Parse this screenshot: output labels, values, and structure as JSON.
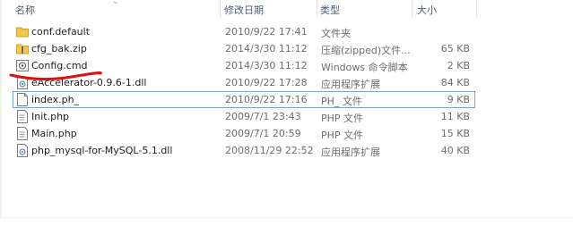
{
  "columns": {
    "name": "名称",
    "modified": "修改日期",
    "type": "类型",
    "size": "大小"
  },
  "files": [
    {
      "name": "conf.default",
      "modified": "2010/9/22 17:41",
      "type": "文件夹",
      "size": "",
      "icon": "folder-icon"
    },
    {
      "name": "cfg_bak.zip",
      "modified": "2014/3/30 11:12",
      "type": "压缩(zipped)文件...",
      "size": "65 KB",
      "icon": "zip-folder-icon"
    },
    {
      "name": "Config.cmd",
      "modified": "2014/3/30 11:12",
      "type": "Windows 命令脚本",
      "size": "2 KB",
      "icon": "cmd-script-icon"
    },
    {
      "name": "eAccelerator-0.9.6-1.dll",
      "modified": "2010/9/22 17:28",
      "type": "应用程序扩展",
      "size": "84 KB",
      "icon": "dll-icon"
    },
    {
      "name": "index.ph_",
      "modified": "2010/9/22 17:16",
      "type": "PH_ 文件",
      "size": "9 KB",
      "icon": "blank-file-icon"
    },
    {
      "name": "Init.php",
      "modified": "2009/7/1 23:43",
      "type": "PHP 文件",
      "size": "11 KB",
      "icon": "text-file-icon"
    },
    {
      "name": "Main.php",
      "modified": "2009/7/1 20:59",
      "type": "PHP 文件",
      "size": "15 KB",
      "icon": "text-file-icon"
    },
    {
      "name": "php_mysql-for-MySQL-5.1.dll",
      "modified": "2008/11/29 22:52",
      "type": "应用程序扩展",
      "size": "40 KB",
      "icon": "dll-icon"
    }
  ],
  "selected_index": 4,
  "colors": {
    "header_text": "#4c607a",
    "annotation_red": "#e01010",
    "selection_border": "#7da2ce"
  }
}
